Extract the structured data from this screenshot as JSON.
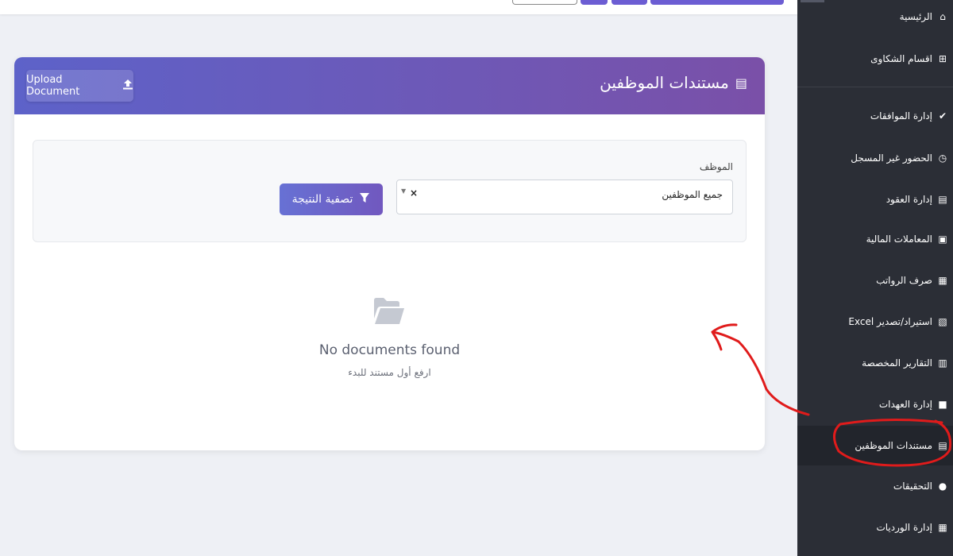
{
  "sidebar": {
    "items": [
      {
        "label": "الرئيسية",
        "icon": "home-icon",
        "glyph": "⌂"
      },
      {
        "label": "اقسام الشكاوى",
        "icon": "sitemap-icon",
        "glyph": "⊞"
      },
      {
        "label": "إدارة الموافقات",
        "icon": "check-circle-icon",
        "glyph": "✔"
      },
      {
        "label": "الحضور غير المسجل",
        "icon": "clock-icon",
        "glyph": "◷"
      },
      {
        "label": "إدارة العقود",
        "icon": "file-icon",
        "glyph": "▤"
      },
      {
        "label": "المعاملات المالية",
        "icon": "money-icon",
        "glyph": "▣"
      },
      {
        "label": "صرف الرواتب",
        "icon": "wallet-icon",
        "glyph": "▦"
      },
      {
        "label": "استيراد/تصدير Excel",
        "icon": "excel-icon",
        "glyph": "▧"
      },
      {
        "label": "التقارير المخصصة",
        "icon": "chart-icon",
        "glyph": "▥"
      },
      {
        "label": "إدارة العهدات",
        "icon": "box-icon",
        "glyph": "■"
      },
      {
        "label": "مستندات الموظفين",
        "icon": "document-icon",
        "glyph": "▤"
      },
      {
        "label": "التحقيقات",
        "icon": "comments-icon",
        "glyph": "●"
      },
      {
        "label": "إدارة الورديات",
        "icon": "calendar-icon",
        "glyph": "▦"
      }
    ]
  },
  "card": {
    "title": "مستندات الموظفين",
    "upload_label": "Upload Document"
  },
  "filter": {
    "label": "الموظف",
    "selected": "جميع الموظفين",
    "clear": "×",
    "button_label": "تصفية النتيجة"
  },
  "empty_state": {
    "title": "No documents found",
    "subtitle": "ارفع أول مستند للبدء"
  },
  "colors": {
    "accent": "#6c5dd3",
    "sidebar_bg": "#2b2e36",
    "annotation": "#e01b1b"
  }
}
